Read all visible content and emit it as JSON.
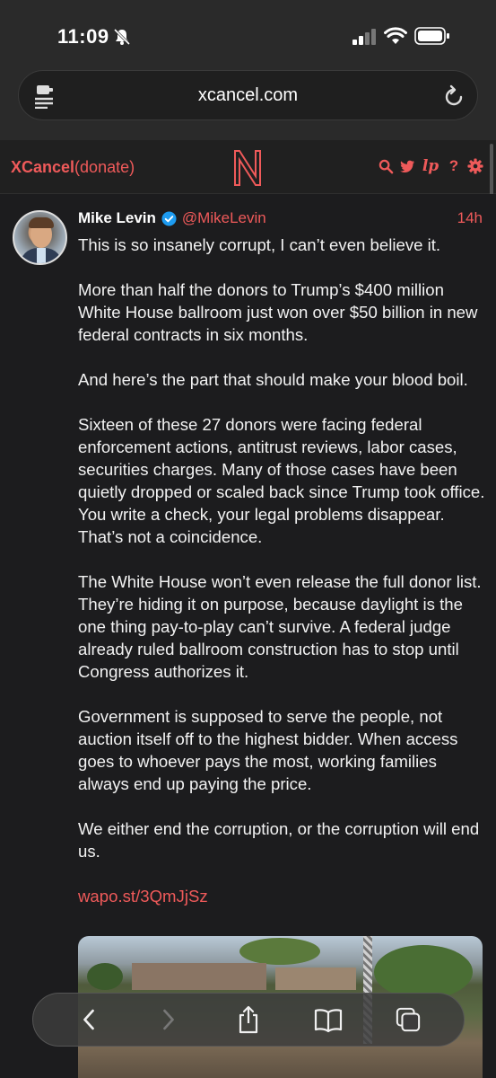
{
  "status_bar": {
    "time": "11:09",
    "icons": [
      "bell-slash-icon",
      "cellular-signal-icon",
      "wifi-icon",
      "battery-icon"
    ]
  },
  "browser": {
    "url": "xcancel.com",
    "icons": [
      "reader-mode-icon",
      "reload-icon"
    ]
  },
  "site_header": {
    "brand_name": "XCancel",
    "brand_suffix": "(donate)",
    "logo_letter": "N",
    "icons": [
      "search-icon",
      "twitter-bird-icon",
      "lp-icon",
      "help-icon",
      "settings-gear-icon"
    ],
    "lp_label": "lp",
    "help_label": "?",
    "accent_color": "#ef5a5a"
  },
  "tweet": {
    "display_name": "Mike Levin",
    "handle": "@MikeLevin",
    "time_ago": "14h",
    "verified": true,
    "paragraphs": [
      "This is so insanely corrupt, I can’t even believe it.",
      "More than half the donors to Trump’s $400 million White House ballroom just won over $50 billion in new federal contracts in six months.",
      "And here’s the part that should make your blood boil.",
      "Sixteen of these 27 donors were facing federal enforcement actions, antitrust reviews, labor cases, securities charges. Many of those cases have been quietly dropped or scaled back since Trump took office. You write a check, your legal problems disappear. That’s not a coincidence.",
      "The White House won’t even release the full donor list. They’re hiding it on purpose, because daylight is the one thing pay-to-play can’t survive. A federal judge already ruled ballroom construction has to stop until Congress authorizes it.",
      "Government is supposed to serve the people, not auction itself off to the highest bidder. When access goes to whoever pays the most, working families always end up paying the price.",
      "We either end the corruption, or the corruption will end us."
    ],
    "link": "wapo.st/3QmJjSz"
  },
  "toolbar": {
    "icons": [
      "back-icon",
      "forward-icon",
      "share-icon",
      "bookmarks-icon",
      "tabs-icon"
    ]
  }
}
